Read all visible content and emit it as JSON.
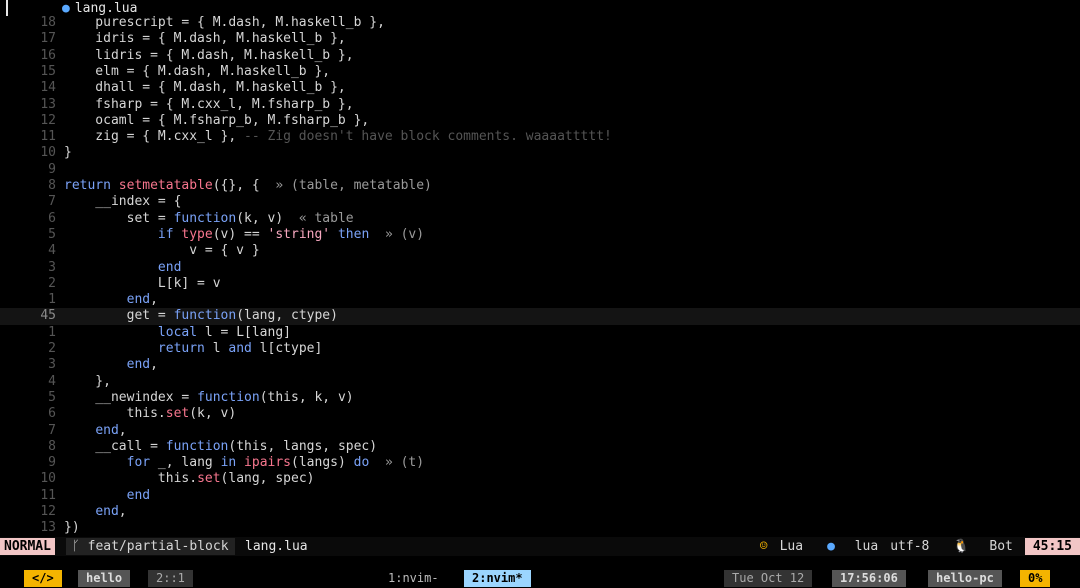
{
  "winbar": {
    "filename": "lang.lua"
  },
  "lines": [
    {
      "n": "18",
      "t": "    purescript = { M.dash, M.haskell_b },"
    },
    {
      "n": "17",
      "t": "    idris = { M.dash, M.haskell_b },"
    },
    {
      "n": "16",
      "t": "    lidris = { M.dash, M.haskell_b },"
    },
    {
      "n": "15",
      "t": "    elm = { M.dash, M.haskell_b },"
    },
    {
      "n": "14",
      "t": "    dhall = { M.dash, M.haskell_b },"
    },
    {
      "n": "13",
      "t": "    fsharp = { M.cxx_l, M.fsharp_b },"
    },
    {
      "n": "12",
      "t": "    ocaml = { M.fsharp_b, M.fsharp_b },"
    },
    {
      "n": "11",
      "t": "    zig = { M.cxx_l }, ",
      "c": "-- Zig doesn't have block comments. waaaattttt!"
    },
    {
      "n": "10",
      "t": "}"
    },
    {
      "n": "9",
      "t": ""
    },
    {
      "n": "8",
      "t": "return setmetatable({}, {  ",
      "v": "» (table, metatable)"
    },
    {
      "n": "7",
      "t": "    __index = {"
    },
    {
      "n": "6",
      "t": "        set = function(k, v)  ",
      "v": "« table"
    },
    {
      "n": "5",
      "t": "            if type(v) == 'string' then  ",
      "v": "» (v)"
    },
    {
      "n": "4",
      "t": "                v = { v }"
    },
    {
      "n": "3",
      "t": "            end"
    },
    {
      "n": "2",
      "t": "            L[k] = v"
    },
    {
      "n": "1",
      "t": "        end,"
    },
    {
      "n": "45",
      "t": "        get = function(lang, ctype)",
      "current": true
    },
    {
      "n": "1",
      "t": "            local l = L[lang]"
    },
    {
      "n": "2",
      "t": "            return l and l[ctype]"
    },
    {
      "n": "3",
      "t": "        end,"
    },
    {
      "n": "4",
      "t": "    },"
    },
    {
      "n": "5",
      "t": "    __newindex = function(this, k, v)"
    },
    {
      "n": "6",
      "t": "        this.set(k, v)"
    },
    {
      "n": "7",
      "t": "    end,"
    },
    {
      "n": "8",
      "t": "    __call = function(this, langs, spec)"
    },
    {
      "n": "9",
      "t": "        for _, lang in ipairs(langs) do  ",
      "v": "» (t)"
    },
    {
      "n": "10",
      "t": "            this.set(lang, spec)"
    },
    {
      "n": "11",
      "t": "        end"
    },
    {
      "n": "12",
      "t": "    end,"
    },
    {
      "n": "13",
      "t": "})"
    }
  ],
  "statusline": {
    "mode": "NORMAL",
    "branch": "feat/partial-block",
    "filename": "lang.lua",
    "filetype_icon": "Lua",
    "lsp": "lua",
    "encoding": "utf-8",
    "os_label": "Bot",
    "position": "45:15"
  },
  "tmux": {
    "tag": "</>",
    "session": "hello",
    "pane": "2::1",
    "win1": "1:nvim-",
    "win2": "2:nvim*",
    "date": "Tue Oct 12",
    "time": "17:56:06",
    "host": "hello-pc",
    "battery": "0%"
  },
  "icons": {
    "file": "lua-moon-icon",
    "branch": "git-branch-icon",
    "cat": "cat-face-icon",
    "linux": "penguin-icon"
  }
}
